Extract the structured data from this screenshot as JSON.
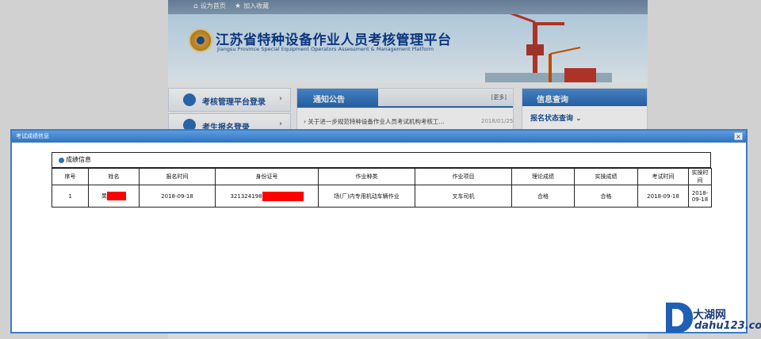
{
  "header": {
    "set_home": "设为首页",
    "add_favorite": "加入收藏",
    "site_title": "江苏省特种设备作业人员考核管理平台",
    "site_subtitle": "Jiangsu Province Special Equipment Operators Assessment & Management Platform"
  },
  "left_nav": {
    "items": [
      {
        "label": "考核管理平台登录"
      },
      {
        "label": "考生报名登录"
      }
    ]
  },
  "notice": {
    "tab_label": "通知公告",
    "more_label": "[更多]",
    "items": [
      {
        "title": "关于进一步规范特种设备作业人员考试机构考核工...",
        "date": "2018/01/25"
      }
    ]
  },
  "info": {
    "title": "信息查询",
    "item": "报名状态查询"
  },
  "modal": {
    "title": "考试成绩信息",
    "close": "×",
    "section_label": "成绩信息",
    "columns": [
      "序号",
      "姓名",
      "报名时间",
      "身份证号",
      "作业种类",
      "作业项目",
      "理论成绩",
      "实操成绩",
      "考试时间",
      "实操时间"
    ],
    "rows": [
      {
        "index": "1",
        "name": "吴",
        "register_date": "2018-09-18",
        "id_number": "321324198",
        "category": "场(厂)内专用机动车辆作业",
        "project": "叉车司机",
        "theory_score": "合格",
        "practical_score": "合格",
        "exam_date": "2018-09-18",
        "practical_date": "2018-09-18"
      }
    ]
  },
  "watermark": {
    "name": "大湖网",
    "url": "dahu123.com"
  },
  "colors": {
    "brand_blue": "#2f6cb0",
    "redaction": "#ff0000"
  }
}
